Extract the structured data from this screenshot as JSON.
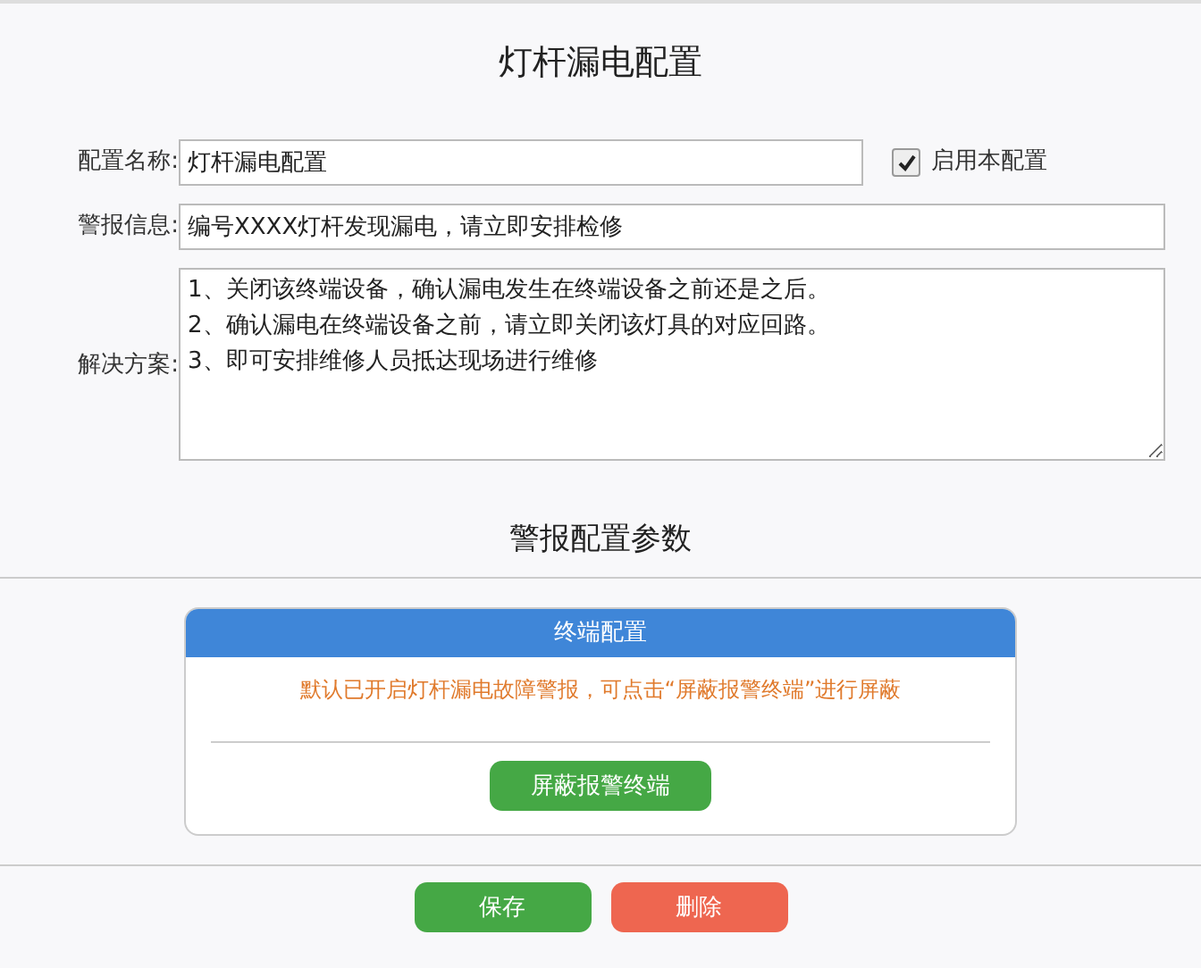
{
  "title": "灯杆漏电配置",
  "fields": [
    {
      "kind": "input",
      "label": "配置名称:",
      "value": "灯杆漏电配置",
      "checkbox": {
        "label": "启用本配置",
        "checked": true
      }
    },
    {
      "kind": "input",
      "label": "警报信息:",
      "value": "编号XXXX灯杆发现漏电，请立即安排检修"
    },
    {
      "kind": "textarea",
      "label": "解决方案:",
      "value": "1、关闭该终端设备，确认漏电发生在终端设备之前还是之后。\n2、确认漏电在终端设备之前，请立即关闭该灯具的对应回路。\n3、即可安排维修人员抵达现场进行维修"
    }
  ],
  "section_title": "警报配置参数",
  "card": {
    "title": "终端配置",
    "notice": "默认已开启灯杆漏电故障警报，可点击“屏蔽报警终端”进行屏蔽",
    "button": "屏蔽报警终端"
  },
  "buttons": [
    {
      "kind": "primary",
      "label": "保存"
    },
    {
      "kind": "danger",
      "label": "删除"
    }
  ]
}
